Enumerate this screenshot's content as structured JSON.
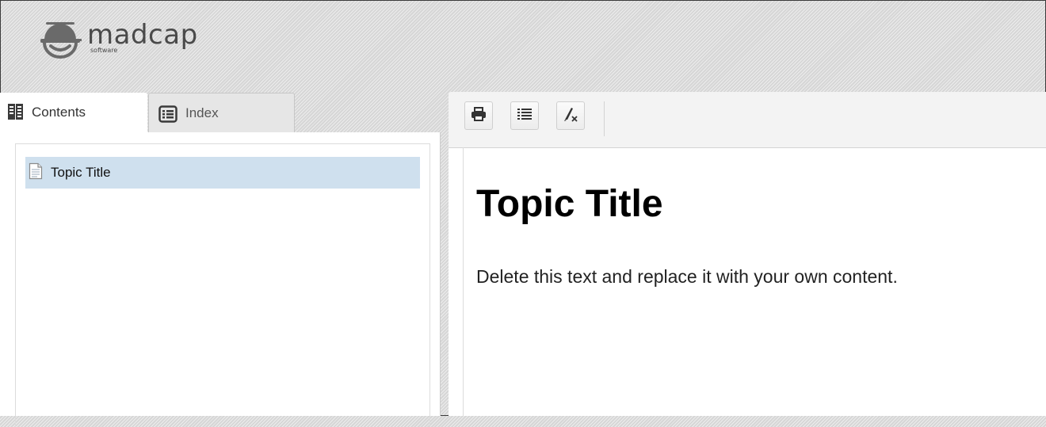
{
  "header": {
    "logo": {
      "name": "madcap",
      "subtitle": "software",
      "icon": "propeller-smiley-icon"
    }
  },
  "sidebar": {
    "tabs": [
      {
        "label": "Contents",
        "icon": "contents-book-icon",
        "active": true
      },
      {
        "label": "Index",
        "icon": "index-list-icon",
        "active": false
      }
    ],
    "toc_items": [
      {
        "label": "Topic Title",
        "icon": "document-icon",
        "selected": true
      }
    ]
  },
  "toolbar": {
    "buttons": [
      {
        "name": "print",
        "icon": "print-icon"
      },
      {
        "name": "toggle-list",
        "icon": "list-icon"
      },
      {
        "name": "remove-highlight",
        "icon": "clear-highlight-icon"
      }
    ]
  },
  "topic": {
    "title": "Topic Title",
    "body": "Delete this text and replace it with your own content."
  },
  "colors": {
    "selection": "#cfe0ee",
    "header_bg": "#d6d6d6"
  }
}
